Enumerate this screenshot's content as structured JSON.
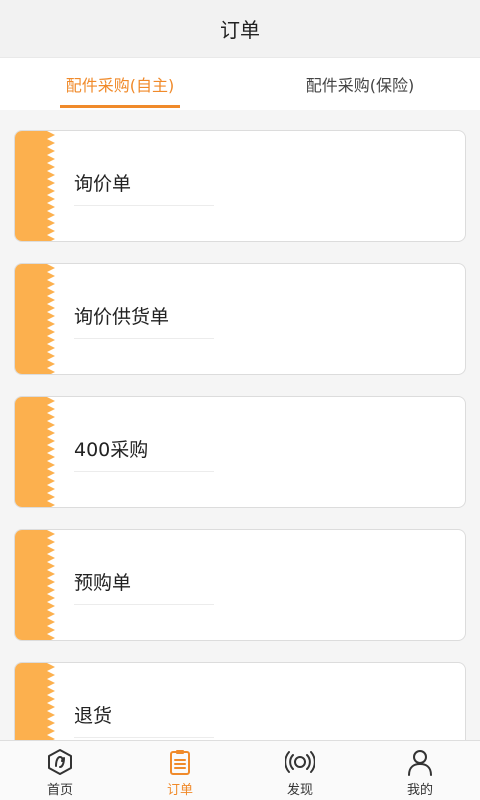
{
  "header": {
    "title": "订单"
  },
  "tabs": [
    {
      "label": "配件采购(自主)",
      "active": true
    },
    {
      "label": "配件采购(保险)",
      "active": false
    }
  ],
  "cards": [
    {
      "label": "询价单"
    },
    {
      "label": "询价供货单"
    },
    {
      "label": "400采购"
    },
    {
      "label": "预购单"
    },
    {
      "label": "退货"
    }
  ],
  "nav": [
    {
      "label": "首页",
      "icon": "home-icon",
      "active": false
    },
    {
      "label": "订单",
      "icon": "order-list-icon",
      "active": true
    },
    {
      "label": "发现",
      "icon": "broadcast-icon",
      "active": false
    },
    {
      "label": "我的",
      "icon": "user-icon",
      "active": false
    }
  ],
  "colors": {
    "accent": "#f08a2a",
    "strip": "#fcb04e"
  }
}
